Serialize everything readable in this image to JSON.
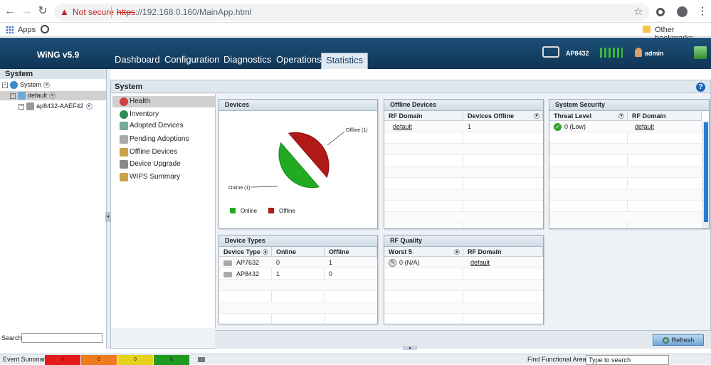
{
  "browser": {
    "not_secure": "Not secure",
    "url_scheme": "https",
    "url_rest": "://192.168.0.160/MainApp.html",
    "bookmarks": {
      "apps": "Apps",
      "other": "Other bookmarks"
    }
  },
  "app": {
    "title": "WiNG v5.9",
    "tabs": [
      "Dashboard",
      "Configuration",
      "Diagnostics",
      "Operations",
      "Statistics"
    ],
    "active_tab": "Statistics",
    "device_label": "AP8432",
    "user": "admin"
  },
  "left": {
    "title": "System",
    "tree": [
      {
        "label": "System",
        "toggle": "⊟"
      },
      {
        "label": "default",
        "toggle": "⊟"
      },
      {
        "label": "ap8432-AAEF42",
        "toggle": "⊟"
      }
    ],
    "search_label": "Search"
  },
  "main": {
    "title": "System",
    "nav": [
      "Health",
      "Inventory",
      "Adopted Devices",
      "Pending Adoptions",
      "Offline Devices",
      "Device Upgrade",
      "WIPS Summary"
    ],
    "active_nav": "Health",
    "refresh": "Refresh"
  },
  "widgets": {
    "devices": {
      "title": "Devices",
      "offline_label": "Offline (1)",
      "online_label": "Online (1)",
      "legend": [
        "Online",
        "Offline"
      ],
      "colors": {
        "online": "#22aa22",
        "offline": "#b11818"
      },
      "online_count": 1,
      "offline_count": 1
    },
    "offline_devices": {
      "title": "Offline Devices",
      "headers": [
        "RF Domain",
        "Devices Offline"
      ],
      "rows": [
        [
          "default",
          "1"
        ]
      ]
    },
    "system_security": {
      "title": "System Security",
      "headers": [
        "Threat Level",
        "RF Domain"
      ],
      "rows": [
        [
          "0 (Low)",
          "default"
        ]
      ]
    },
    "device_types": {
      "title": "Device Types",
      "headers": [
        "Device Type",
        "Online",
        "Offline"
      ],
      "rows": [
        [
          "AP7632",
          "0",
          "1"
        ],
        [
          "AP8432",
          "1",
          "0"
        ]
      ]
    },
    "rf_quality": {
      "title": "RF Quality",
      "headers": [
        "Worst 5",
        "RF Domain"
      ],
      "rows": [
        [
          "0 (N/A)",
          "default"
        ]
      ]
    }
  },
  "status": {
    "event_summary": "Event Summary",
    "events": [
      {
        "value": "0",
        "color": "#e51b1b"
      },
      {
        "value": "0",
        "color": "#f07a1e"
      },
      {
        "value": "0",
        "color": "#e6d21e"
      },
      {
        "value": "0",
        "color": "#1e9a1e"
      }
    ],
    "find_label": "Find Functional Area",
    "find_placeholder": "Type to search"
  }
}
